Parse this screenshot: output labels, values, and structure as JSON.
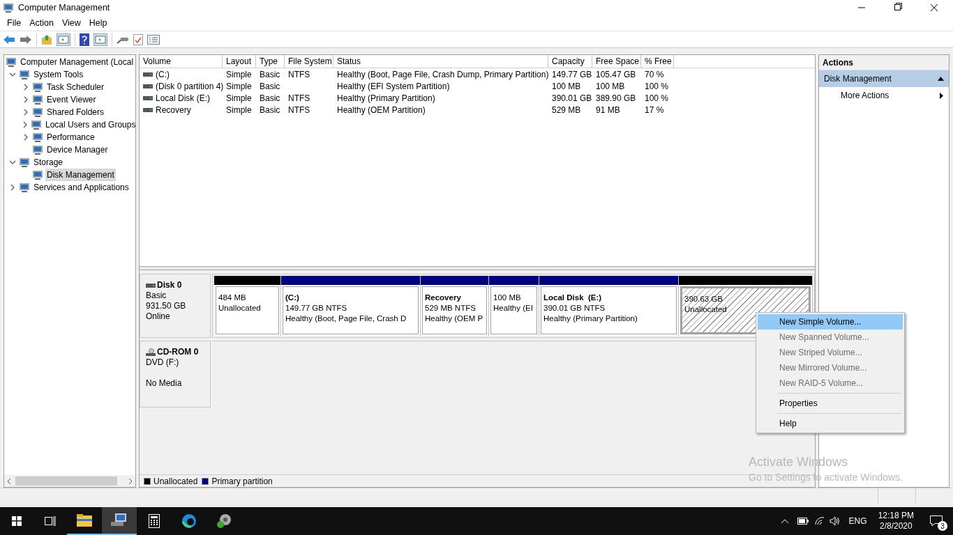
{
  "window": {
    "title": "Computer Management"
  },
  "menu": [
    "File",
    "Action",
    "View",
    "Help"
  ],
  "tree": [
    {
      "label": "Computer Management (Local",
      "selected": false,
      "children": [
        {
          "label": "System Tools",
          "selected": false,
          "expanded": true,
          "children": [
            {
              "label": "Task Scheduler",
              "selected": false,
              "expanded": false
            },
            {
              "label": "Event Viewer",
              "selected": false,
              "expanded": false
            },
            {
              "label": "Shared Folders",
              "selected": false,
              "expanded": false
            },
            {
              "label": "Local Users and Groups",
              "selected": false,
              "expanded": false
            },
            {
              "label": "Performance",
              "selected": false,
              "expanded": false
            },
            {
              "label": "Device Manager",
              "selected": false
            }
          ]
        },
        {
          "label": "Storage",
          "selected": false,
          "expanded": true,
          "children": [
            {
              "label": "Disk Management",
              "selected": true
            }
          ]
        },
        {
          "label": "Services and Applications",
          "selected": false,
          "expanded": false
        }
      ]
    }
  ],
  "table": {
    "columns": [
      "Volume",
      "Layout",
      "Type",
      "File System",
      "Status",
      "Capacity",
      "Free Space",
      "% Free"
    ],
    "rows": [
      [
        "(C:)",
        "Simple",
        "Basic",
        "NTFS",
        "Healthy (Boot, Page File, Crash Dump, Primary Partition)",
        "149.77 GB",
        "105.47 GB",
        "70 %"
      ],
      [
        "(Disk 0 partition 4)",
        "Simple",
        "Basic",
        "",
        "Healthy (EFI System Partition)",
        "100 MB",
        "100 MB",
        "100 %"
      ],
      [
        "Local Disk (E:)",
        "Simple",
        "Basic",
        "NTFS",
        "Healthy (Primary Partition)",
        "390.01 GB",
        "389.90 GB",
        "100 %"
      ],
      [
        "Recovery",
        "Simple",
        "Basic",
        "NTFS",
        "Healthy (OEM Partition)",
        "529 MB",
        "91 MB",
        "17 %"
      ]
    ]
  },
  "disks": [
    {
      "kind": "disk",
      "name": "Disk 0",
      "lines": [
        "Basic",
        "931.50 GB",
        "Online"
      ],
      "partitions": [
        {
          "kind": "unallocated",
          "selected": false,
          "lines": [
            "484 MB",
            "Unallocated"
          ]
        },
        {
          "kind": "primary",
          "selected": false,
          "title": "(C:)",
          "lines": [
            "149.77 GB NTFS",
            "Healthy (Boot, Page File, Crash D"
          ]
        },
        {
          "kind": "primary",
          "selected": false,
          "title": "Recovery",
          "lines": [
            "529 MB NTFS",
            "Healthy (OEM P"
          ]
        },
        {
          "kind": "primary",
          "selected": false,
          "lines": [
            "100 MB",
            "Healthy (EI"
          ]
        },
        {
          "kind": "primary",
          "selected": false,
          "title": "Local Disk  (E:)",
          "lines": [
            "390.01 GB NTFS",
            "Healthy (Primary Partition)"
          ]
        },
        {
          "kind": "unallocated",
          "selected": true,
          "lines": [
            "390.63 GB",
            "Unallocated"
          ]
        }
      ]
    },
    {
      "kind": "cdrom",
      "name": "CD-ROM 0",
      "lines": [
        "DVD (F:)",
        "No Media"
      ]
    }
  ],
  "legend": [
    {
      "label": "Unallocated",
      "color": "#000000"
    },
    {
      "label": "Primary partition",
      "color": "#000080"
    }
  ],
  "actions": {
    "title": "Actions",
    "section": "Disk Management",
    "items": [
      "More Actions"
    ]
  },
  "context_menu": [
    {
      "label": "New Simple Volume...",
      "disabled": false,
      "selected": true
    },
    {
      "label": "New Spanned Volume...",
      "disabled": true,
      "selected": false
    },
    {
      "label": "New Striped Volume...",
      "disabled": true,
      "selected": false
    },
    {
      "label": "New Mirrored Volume...",
      "disabled": true,
      "selected": false
    },
    {
      "label": "New RAID-5 Volume...",
      "disabled": true,
      "selected": false,
      "separator_after": true
    },
    {
      "label": "Properties",
      "disabled": false,
      "selected": false,
      "separator_after": true
    },
    {
      "label": "Help",
      "disabled": false,
      "selected": false
    }
  ],
  "activation_notice": {
    "title": "Activate Windows",
    "text": "Go to Settings to activate Windows."
  },
  "taskbar": {
    "language": "ENG",
    "time": "12:18 PM",
    "date": "2/8/2020",
    "notifications": "3"
  }
}
